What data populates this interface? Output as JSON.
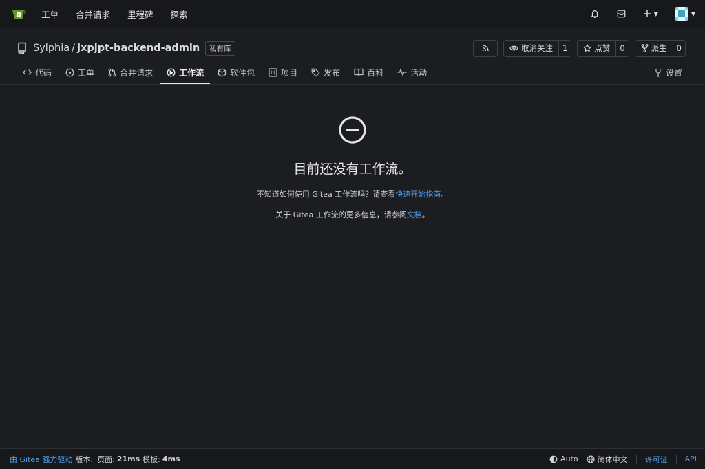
{
  "topnav": {
    "links": [
      "工单",
      "合并请求",
      "里程碑",
      "探索"
    ],
    "icons": [
      "bell-icon",
      "tray-icon",
      "plus-icon",
      "avatar"
    ],
    "brand_color": "#609926"
  },
  "repo": {
    "owner": "Sylphia",
    "separator": "/",
    "name": "jxpjpt-backend-admin",
    "visibility_label": "私有库",
    "unwatch_label": "取消关注",
    "watch_count": "1",
    "star_label": "点赞",
    "star_count": "0",
    "fork_label": "派生",
    "fork_count": "0"
  },
  "tabs": [
    {
      "label": "代码",
      "icon": "code-icon"
    },
    {
      "label": "工单",
      "icon": "issue-icon"
    },
    {
      "label": "合并请求",
      "icon": "pull-request-icon"
    },
    {
      "label": "工作流",
      "icon": "play-icon",
      "active": true
    },
    {
      "label": "软件包",
      "icon": "package-icon"
    },
    {
      "label": "项目",
      "icon": "project-icon"
    },
    {
      "label": "发布",
      "icon": "tag-icon"
    },
    {
      "label": "百科",
      "icon": "book-icon"
    },
    {
      "label": "活动",
      "icon": "pulse-icon"
    },
    {
      "label": "设置",
      "icon": "tools-icon"
    }
  ],
  "empty": {
    "title": "目前还没有工作流。",
    "line1_prefix": "不知道如何使用 Gitea 工作流吗？请查看",
    "line1_link": "快速开始指南",
    "line1_suffix": "。",
    "line2_prefix": "关于 Gitea 工作流的更多信息，请参阅",
    "line2_link": "文档",
    "line2_suffix": "。"
  },
  "footer": {
    "powered_by": "由 Gitea 强力驱动",
    "version_label": "版本:",
    "page_label": "页面:",
    "page_time": "21ms",
    "template_label": "模板:",
    "template_time": "4ms",
    "theme": "Auto",
    "language": "简体中文",
    "license": "许可证",
    "api": "API"
  },
  "colors": {
    "link": "#4b9ce8",
    "background": "#1c1d21"
  }
}
